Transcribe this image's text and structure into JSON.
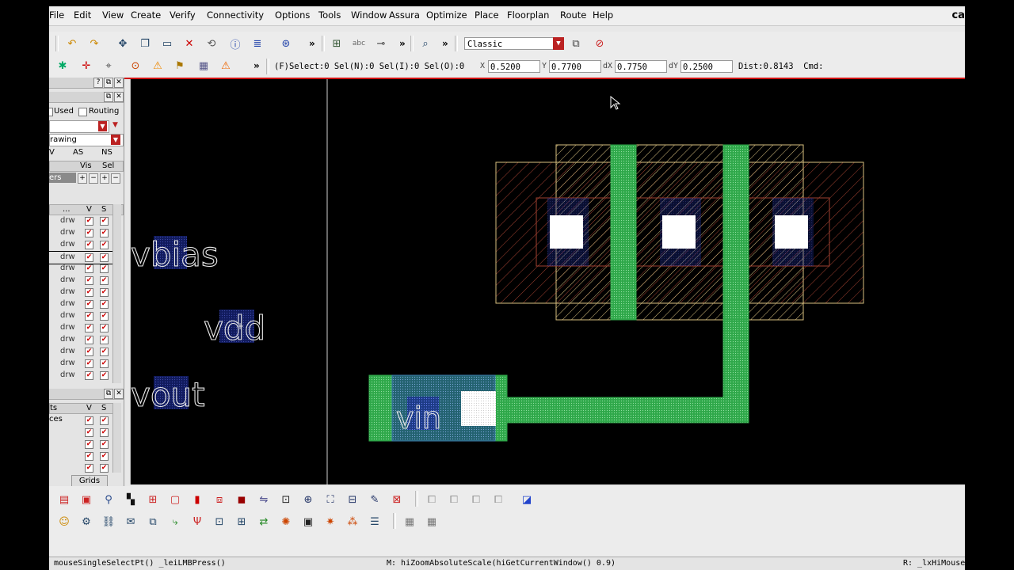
{
  "menubar": {
    "items": [
      "File",
      "Edit",
      "View",
      "Create",
      "Verify",
      "Connectivity",
      "Options",
      "Tools",
      "Window",
      "Assura",
      "Optimize",
      "Place",
      "Floorplan",
      "Route",
      "Help"
    ],
    "brand": "ca"
  },
  "toolbar": {
    "view_mode": "Classic"
  },
  "status": {
    "select_info": "(F)Select:0  Sel(N):0  Sel(I):0  Sel(O):0",
    "x_label": "X",
    "x_value": "0.5200",
    "y_label": "Y",
    "y_value": "0.7700",
    "dx_label": "dX",
    "dx_value": "0.7750",
    "dy_label": "dY",
    "dy_value": "0.2500",
    "dist": "Dist:0.8143",
    "cmd_label": "Cmd:"
  },
  "left_panel": {
    "used_label": "Used",
    "routing_label": "Routing",
    "purpose_value": "rawing",
    "col_v": "V",
    "col_as": "AS",
    "col_ns": "NS",
    "vis_label": "Vis",
    "sel_label": "Sel",
    "layers_label": "ers",
    "list_header": "...",
    "list_v": "V",
    "list_s": "S",
    "layer_purpose": "drw",
    "layer_count": 14,
    "objects_label_1": "ts",
    "objects_label_2": "ces",
    "objects_v": "V",
    "objects_s": "S",
    "grids_tab": "Grids"
  },
  "canvas": {
    "pins": [
      "vbias",
      "vdd",
      "vout",
      "vin"
    ]
  },
  "cmdline": {
    "left": "mouseSingleSelectPt() _leiLMBPress()",
    "middle": "M: hiZoomAbsoluteScale(hiGetCurrentWindow() 0.9)",
    "right": "R: _lxHiMouse"
  },
  "colors": {
    "canvas_bg": "#000000",
    "poly": "#2fa84a",
    "metal_outline": "#9090ff",
    "diffusion_outline": "#d8c080",
    "nwell_outline": "#b05040",
    "contact": "#ffffff",
    "accent_red": "#d01010"
  }
}
